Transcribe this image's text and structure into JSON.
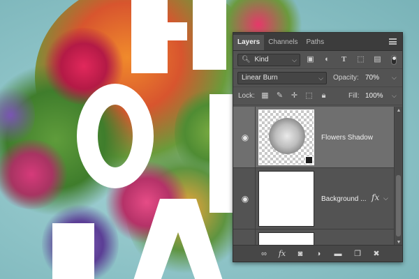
{
  "panel": {
    "tabs": [
      {
        "label": "Layers",
        "active": true
      },
      {
        "label": "Channels",
        "active": false
      },
      {
        "label": "Paths",
        "active": false
      }
    ],
    "filter": {
      "value": "Kind",
      "icons": [
        "image-filter-icon",
        "adjustment-filter-icon",
        "type-filter-icon",
        "shape-filter-icon",
        "smart-object-filter-icon",
        "filter-toggle-icon"
      ]
    },
    "blend_mode": {
      "value": "Linear Burn"
    },
    "opacity": {
      "label": "Opacity:",
      "value": "70%"
    },
    "lock": {
      "label": "Lock:",
      "icons": [
        "lock-transparent-icon",
        "lock-paint-icon",
        "lock-move-icon",
        "lock-artboard-icon",
        "lock-all-icon"
      ]
    },
    "fill": {
      "label": "Fill:",
      "value": "100%"
    },
    "layers": [
      {
        "name": "Flowers Shadow",
        "selected": true,
        "visible": true,
        "has_fx": false
      },
      {
        "name": "Background ...",
        "selected": false,
        "visible": true,
        "has_fx": true,
        "fx_label": "fx"
      }
    ],
    "footer_icons": [
      "link-layers-icon",
      "fx-icon",
      "add-mask-icon",
      "adjustment-layer-icon",
      "new-group-icon",
      "new-layer-icon",
      "trash-icon"
    ],
    "fx_footer_label": "fx"
  },
  "colors": {
    "panel_bg": "#535353",
    "selected_row": "#6f6f6f",
    "canvas_bg": "#8fc3c7"
  }
}
